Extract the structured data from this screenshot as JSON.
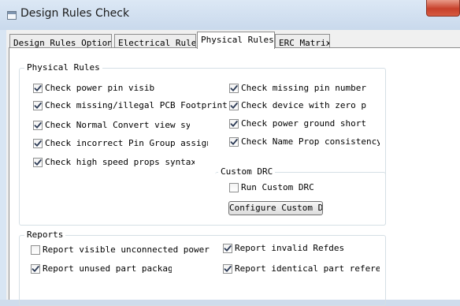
{
  "window": {
    "title": "Design Rules Check"
  },
  "tabs": [
    {
      "label": "Design Rules Options"
    },
    {
      "label": "Electrical Rules"
    },
    {
      "label": "Physical Rules"
    },
    {
      "label": "ERC Matrix"
    }
  ],
  "physical_rules": {
    "group_label": "Physical Rules",
    "left": [
      {
        "label": "Check power pin visib",
        "checked": true
      },
      {
        "label": "Check missing/illegal PCB Footprint p",
        "checked": true
      },
      {
        "label": "Check Normal Convert view sy",
        "checked": true
      },
      {
        "label": "Check incorrect Pin Group assign",
        "checked": true
      },
      {
        "label": "Check high speed props syntax",
        "checked": true
      }
    ],
    "right": [
      {
        "label": "Check missing pin number",
        "checked": true
      },
      {
        "label": "Check device with zero pi",
        "checked": true
      },
      {
        "label": "Check power ground short",
        "checked": true
      },
      {
        "label": "Check Name Prop consistency",
        "checked": true
      }
    ]
  },
  "custom_drc": {
    "group_label": "Custom DRC",
    "run_label": "Run Custom DRC",
    "run_checked": false,
    "configure_button": "Configure Custom DRC"
  },
  "reports": {
    "group_label": "Reports",
    "left": [
      {
        "label": "Report visible unconnected power",
        "checked": false
      },
      {
        "label": "Report unused part packag",
        "checked": true
      }
    ],
    "right": [
      {
        "label": "Report invalid Refdes",
        "checked": true
      },
      {
        "label": "Report identical part refere",
        "checked": true
      }
    ]
  }
}
